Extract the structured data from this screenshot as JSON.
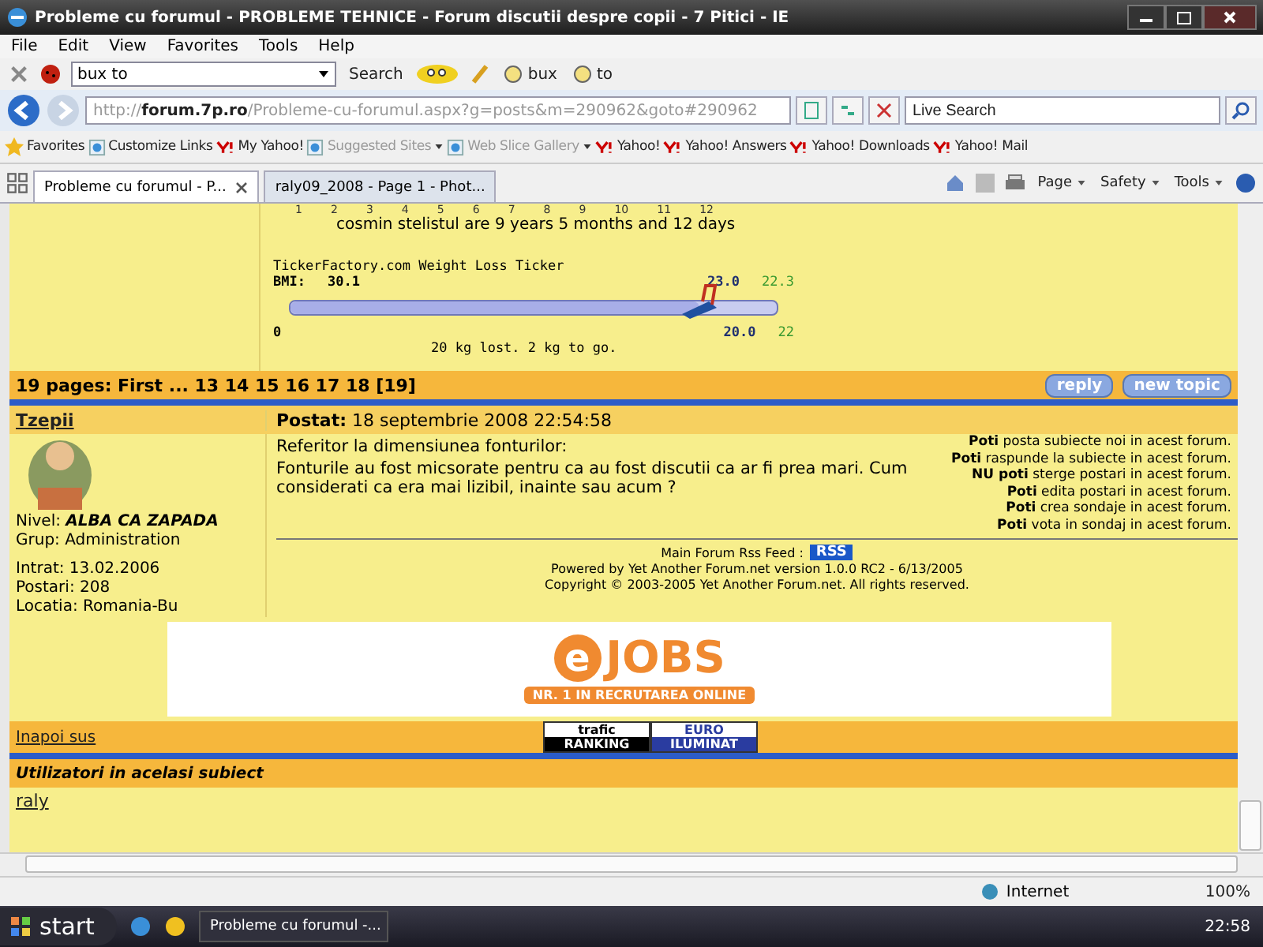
{
  "window": {
    "title": "Probleme cu forumul - PROBLEME TEHNICE - Forum discutii despre copii - 7 Pitici - IE"
  },
  "menu": [
    "File",
    "Edit",
    "View",
    "Favorites",
    "Tools",
    "Help"
  ],
  "toolbar": {
    "search_value": "bux to",
    "search_label": "Search",
    "links": [
      "bux",
      "to"
    ]
  },
  "address_bar": {
    "url": "http://**forum.7p.ro**/Probleme-cu-forumul.aspx?g=posts&m=290962&goto#290962",
    "search_placeholder": "Live Search"
  },
  "favorites_bar": {
    "label": "Favorites",
    "links": [
      {
        "text": "Customize Links",
        "kind": "page",
        "disabled": false,
        "dropdown": false
      },
      {
        "text": "My Yahoo!",
        "kind": "yahoo",
        "disabled": false,
        "dropdown": false
      },
      {
        "text": "Suggested Sites",
        "kind": "page",
        "disabled": true,
        "dropdown": true
      },
      {
        "text": "Web Slice Gallery",
        "kind": "page",
        "disabled": true,
        "dropdown": true
      },
      {
        "text": "Yahoo!",
        "kind": "yahoo",
        "disabled": false,
        "dropdown": false
      },
      {
        "text": "Yahoo! Answers",
        "kind": "yahoo",
        "disabled": false,
        "dropdown": false
      },
      {
        "text": "Yahoo! Downloads",
        "kind": "yahoo",
        "disabled": false,
        "dropdown": false
      },
      {
        "text": "Yahoo! Mail",
        "kind": "yahoo",
        "disabled": false,
        "dropdown": false
      }
    ]
  },
  "tabs": [
    {
      "title": "Probleme cu forumul - P...",
      "selected": true
    },
    {
      "title": "raly09_2008 - Page 1 - Phot...",
      "selected": false
    }
  ],
  "command_bar": [
    "Page",
    "Safety",
    "Tools"
  ],
  "signature": {
    "ticks": [
      "1",
      "2",
      "3",
      "4",
      "5",
      "6",
      "7",
      "8",
      "9",
      "10",
      "11",
      "12"
    ],
    "age_text": "cosmin stelistul are 9 years 5 months and 12 days",
    "weight": {
      "title": "TickerFactory.com Weight Loss Ticker",
      "bmi_label": "BMI:",
      "bmi_start": "30.1",
      "bmi_current": "23.0",
      "bmi_goal": "22.3",
      "level": 0.84,
      "start_kg": "0",
      "current_kg": "20.0",
      "goal_kg": "22",
      "summary": "20 kg lost. 2 kg to go."
    }
  },
  "pager": {
    "text": "19 pages: First ... 13 14 15 16 17 18 [19]",
    "buttons": [
      "reply",
      "new topic"
    ]
  },
  "post": {
    "author": "Tzepii",
    "posted_label": "Postat:",
    "posted": "18 septembrie 2008 22:54:58",
    "level_label": "Nivel:",
    "level_value": "ALBA CA ZAPADA",
    "group": "Grup: Administration",
    "joined": "Intrat: 13.02.2006",
    "posts": "Postari: 208",
    "location": "Locatia: Romania-Bu",
    "message": [
      "Referitor la dimensiunea fonturilor:",
      "Fonturile au fost micsorate pentru ca au fost discutii ca ar fi prea mari. Cum considerati ca era mai lizibil, inainte sau acum ?"
    ]
  },
  "permissions": [
    "**Poti** posta subiecte noi in acest forum.",
    "**Poti** raspunde la subiecte in acest forum.",
    "**NU poti** sterge postari in acest forum.",
    "**Poti** edita postari in acest forum.",
    "**Poti** crea sondaje in acest forum.",
    "**Poti** vota in sondaj in acest forum."
  ],
  "footer": {
    "rss_label": "Main Forum Rss Feed :",
    "rss_button": "RSS",
    "powered": "Powered by Yet Another Forum.net version 1.0.0 RC2 - 6/13/2005",
    "copyright": "Copyright © 2003-2005 Yet Another Forum.net. All rights reserved."
  },
  "ad": {
    "mark": "e",
    "logo": "JOBS",
    "tagline": "NR. 1 IN RECRUTAREA ONLINE"
  },
  "back_to_top": "Inapoi sus",
  "badges": [
    {
      "top": "trafic",
      "bottom": "RANKING",
      "kind": "trafic"
    },
    {
      "top": "EURO",
      "bottom": "ILUMINAT",
      "kind": "euro"
    }
  ],
  "same_topic": {
    "title": "Utilizatori in acelasi subiect",
    "users": [
      "raly"
    ]
  },
  "status_bar": {
    "zone": "Internet",
    "zoom": "100%"
  },
  "taskbar": {
    "start": "start",
    "tasks": [
      {
        "title": "Probleme cu forumul -...",
        "selected": false
      }
    ],
    "clock": "22:58"
  }
}
